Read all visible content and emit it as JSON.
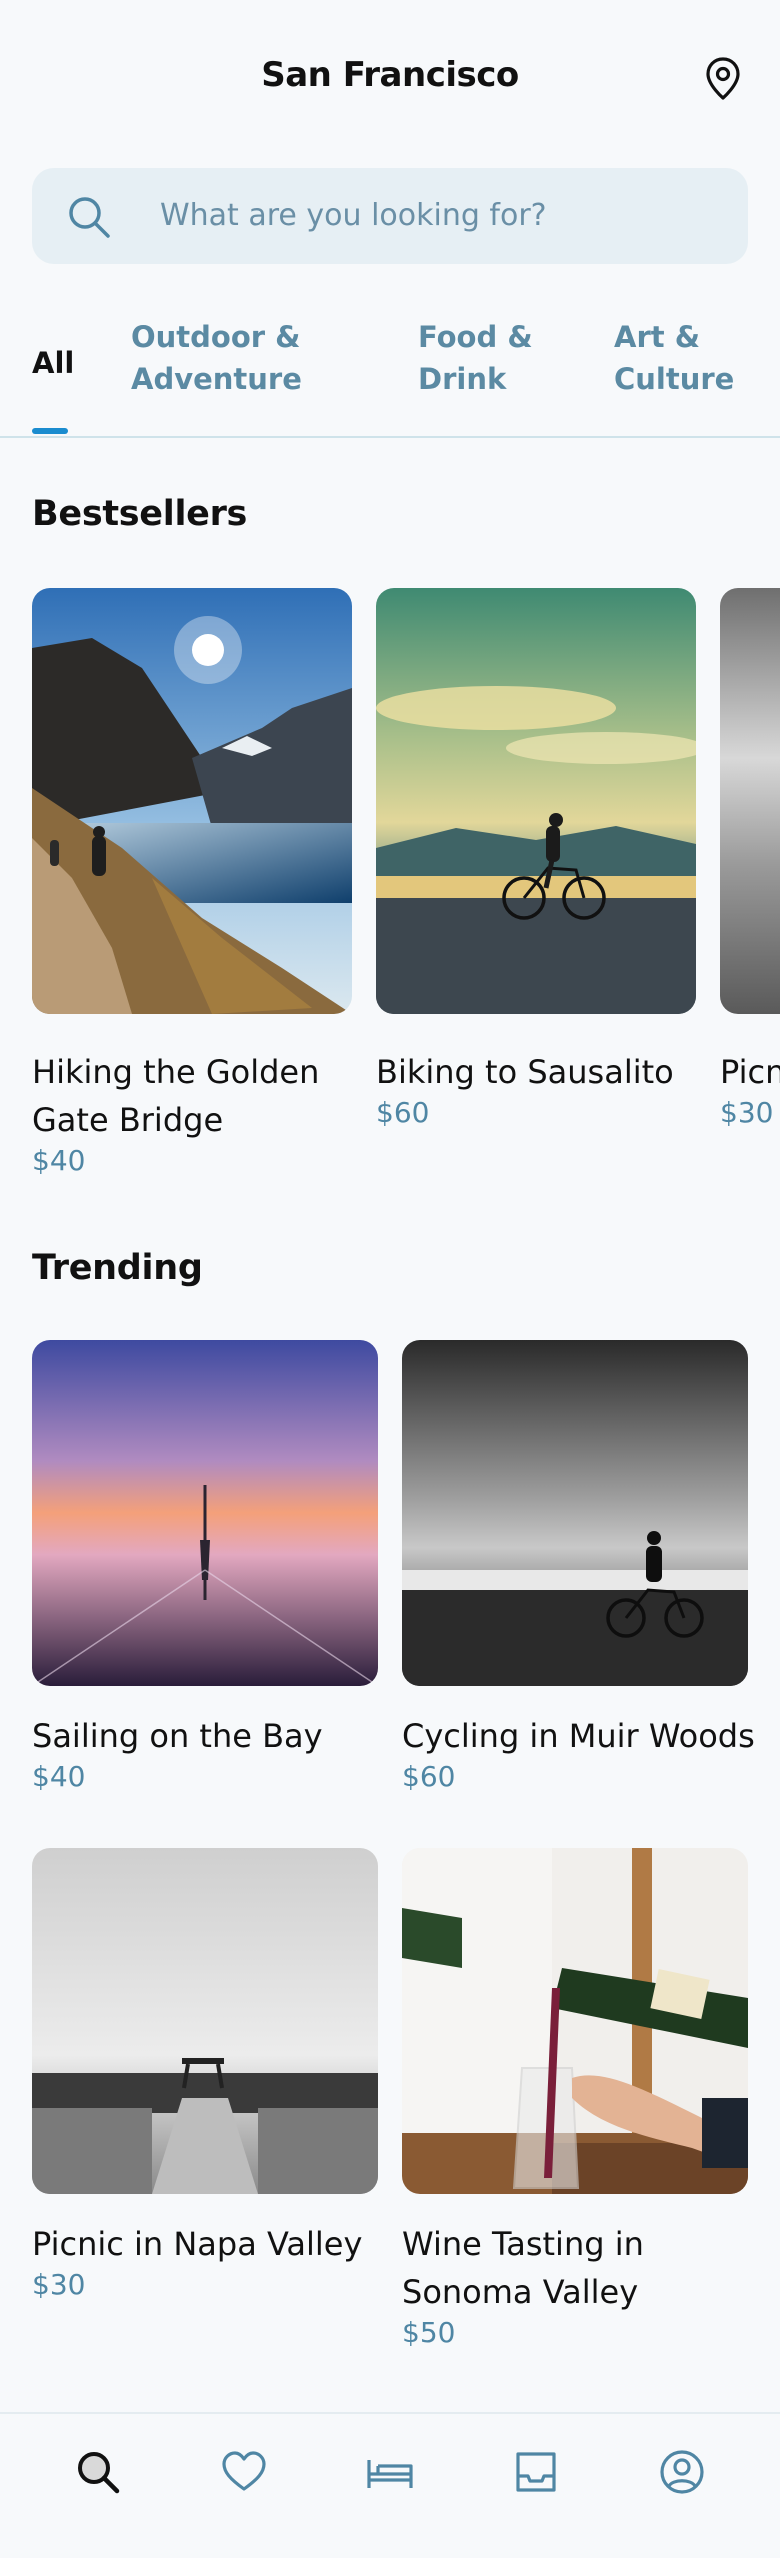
{
  "header": {
    "title": "San Francisco",
    "location_icon": "map-pin-icon"
  },
  "search": {
    "placeholder": "What are you looking for?",
    "icon": "search-icon"
  },
  "tabs": [
    {
      "line1": "All",
      "line2": ""
    },
    {
      "line1": "Outdoor &",
      "line2": "Adventure"
    },
    {
      "line1": "Food &",
      "line2": "Drink"
    },
    {
      "line1": "Art &",
      "line2": "Culture"
    }
  ],
  "bestsellers": {
    "title": "Bestsellers",
    "items": [
      {
        "title_line1": "Hiking the Golden",
        "title_line2": "Gate Bridge",
        "price": "$40"
      },
      {
        "title_line1": "Biking to Sausalito",
        "title_line2": "",
        "price": "$60"
      },
      {
        "title_line1": "Picnic",
        "title_line2": "",
        "price": "$30"
      }
    ]
  },
  "trending": {
    "title": "Trending",
    "items": [
      {
        "title_line1": "Sailing on the Bay",
        "title_line2": "",
        "price": "$40"
      },
      {
        "title_line1": "Cycling in Muir Woods",
        "title_line2": "",
        "price": "$60"
      },
      {
        "title_line1": "Picnic in Napa Valley",
        "title_line2": "",
        "price": "$30"
      },
      {
        "title_line1": "Wine Tasting in",
        "title_line2": "Sonoma Valley",
        "price": "$50"
      }
    ]
  },
  "bottom_nav": [
    {
      "icon": "search-icon",
      "active": true
    },
    {
      "icon": "heart-icon",
      "active": false
    },
    {
      "icon": "bed-icon",
      "active": false
    },
    {
      "icon": "inbox-icon",
      "active": false
    },
    {
      "icon": "profile-icon",
      "active": false
    }
  ],
  "colors": {
    "accent": "#1a8ccf",
    "price": "#4f86a4",
    "tab_inactive": "#5b8aa3",
    "search_bg": "#e6eff4"
  }
}
